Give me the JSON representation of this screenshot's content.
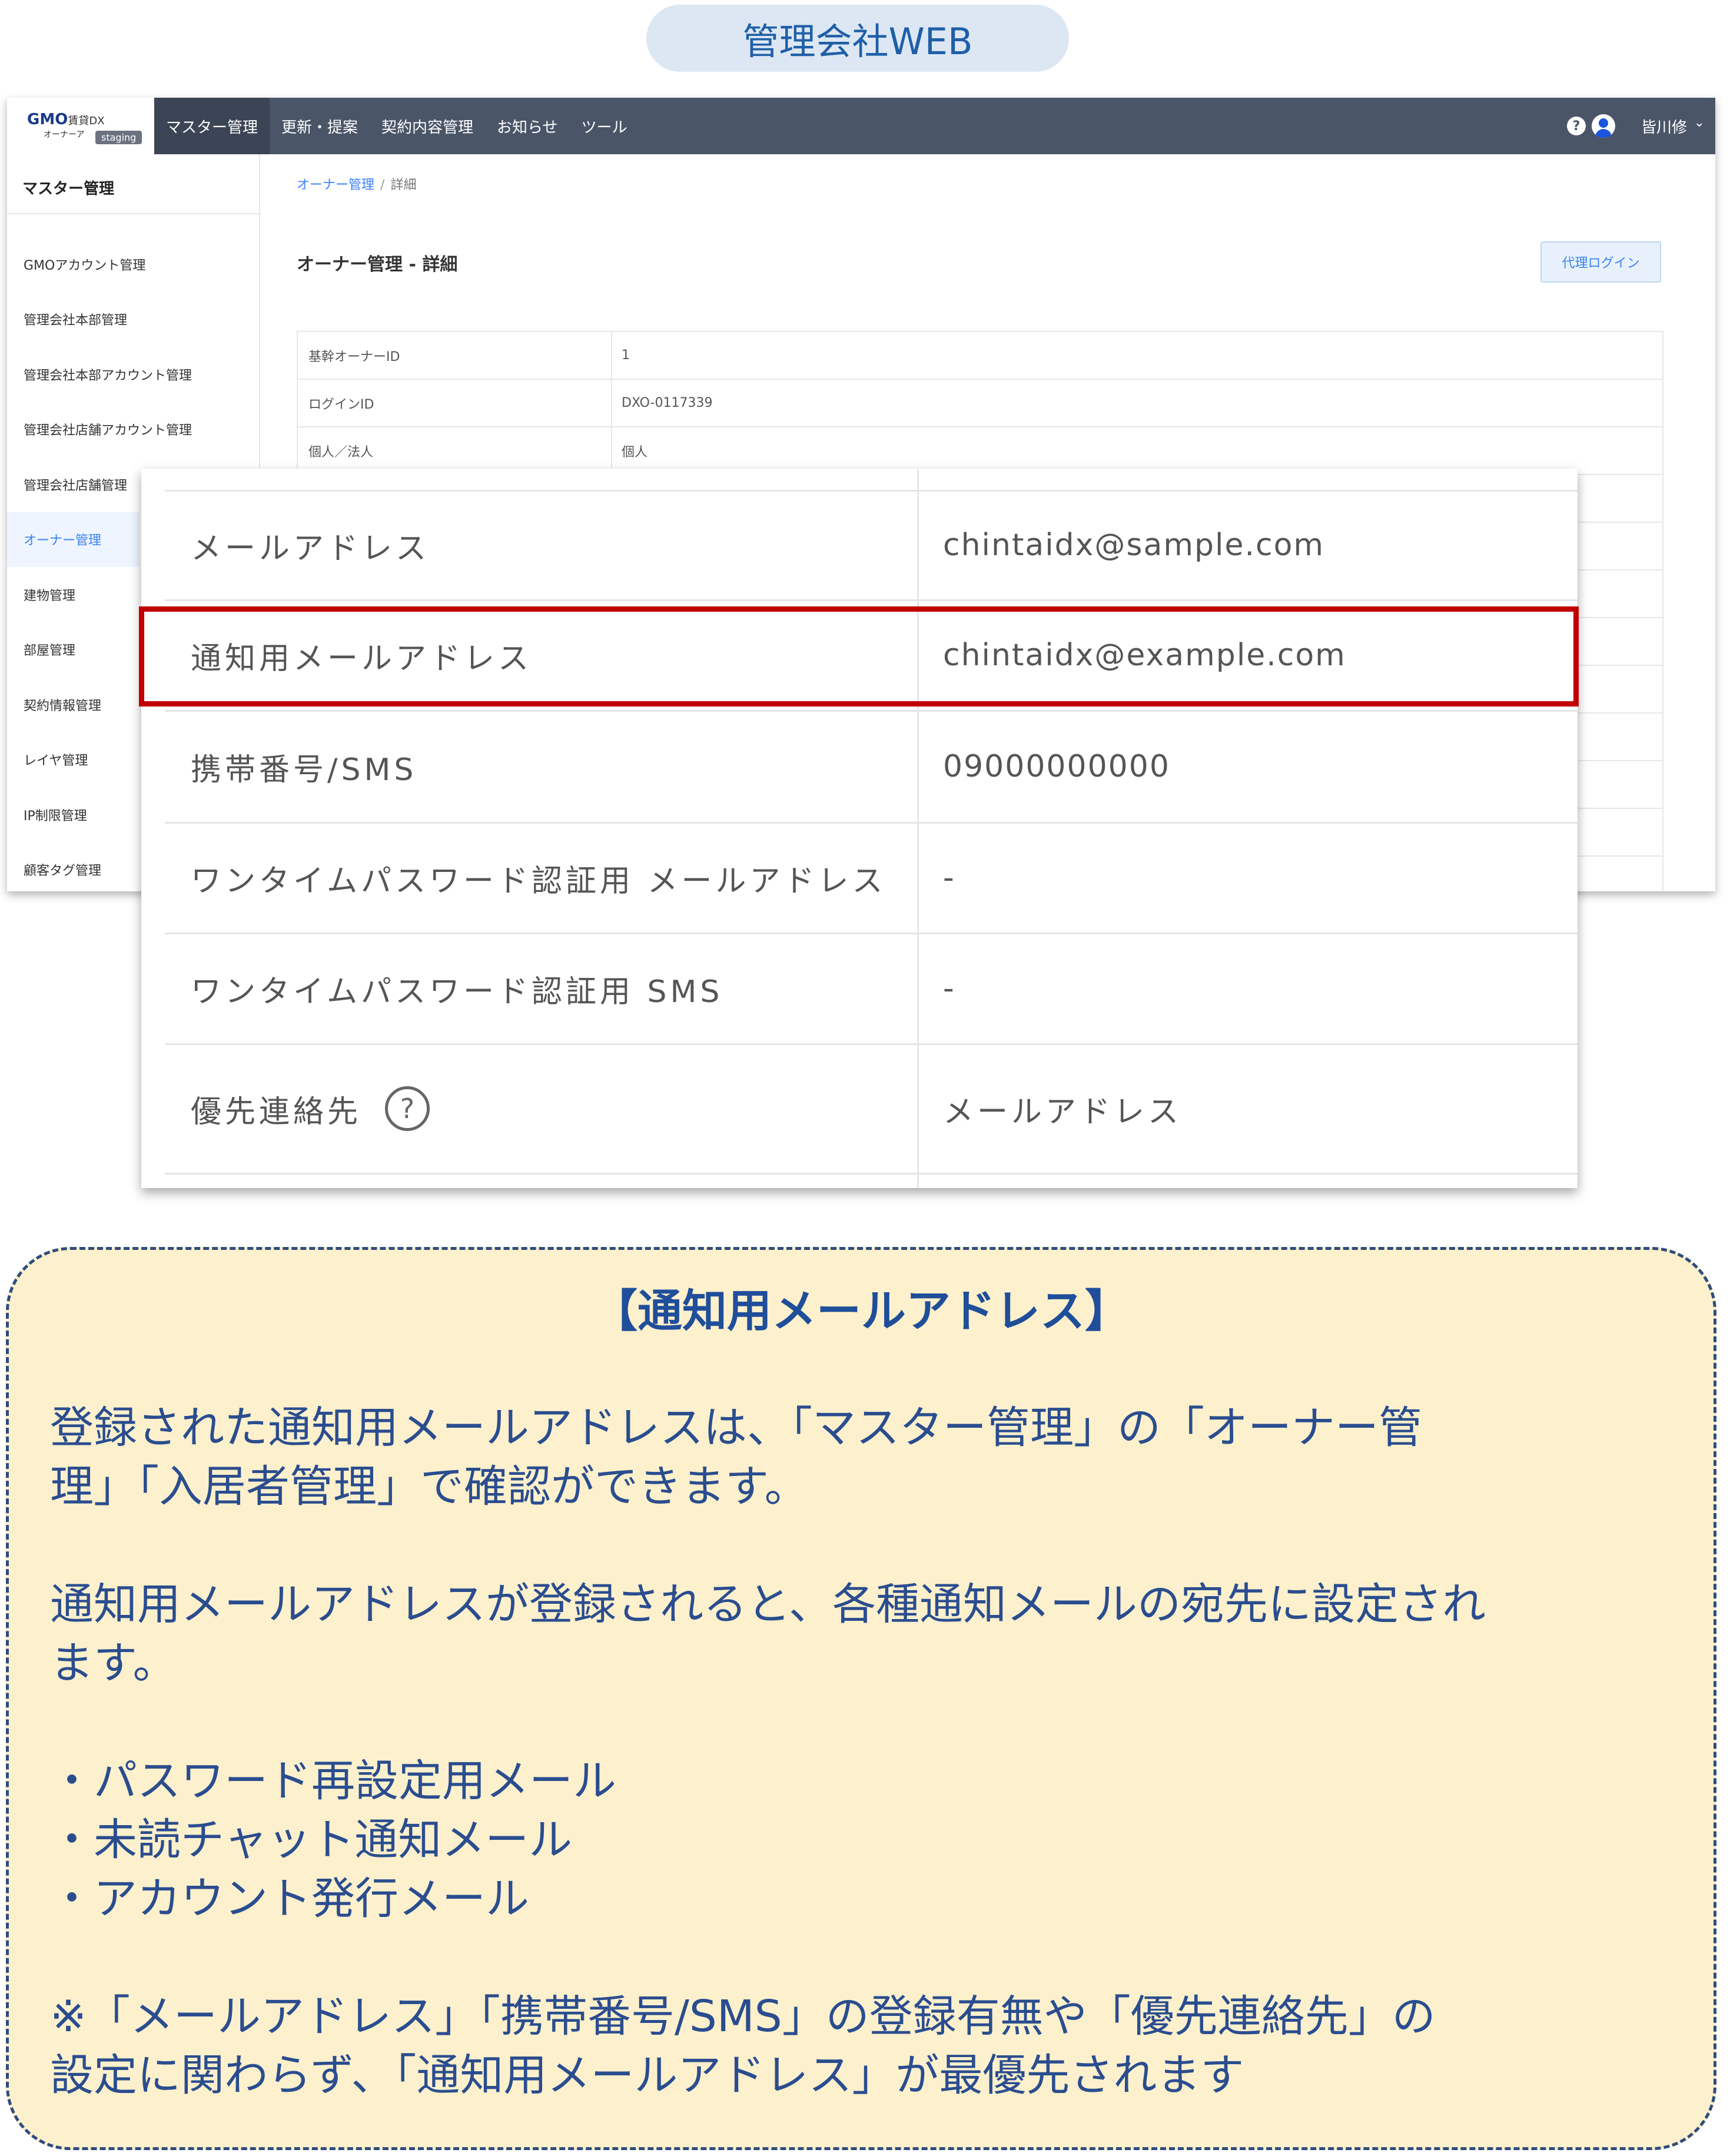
{
  "header_pill": "管理会社WEB",
  "app": {
    "logo": {
      "main": "GMO",
      "product": "賃貸DX",
      "sub": "オーナーア",
      "env": "staging"
    },
    "nav": [
      "マスター管理",
      "更新・提案",
      "契約内容管理",
      "お知らせ",
      "ツール"
    ],
    "help": "?",
    "user_name": "皆川修",
    "user_caret": "⌄",
    "sidebar": {
      "title": "マスター管理",
      "items": [
        "GMOアカウント管理",
        "管理会社本部管理",
        "管理会社本部アカウント管理",
        "管理会社店舗アカウント管理",
        "管理会社店舗管理",
        "オーナー管理",
        "建物管理",
        "部屋管理",
        "契約情報管理",
        "レイヤ管理",
        "IP制限管理",
        "顧客タグ管理"
      ]
    },
    "breadcrumb": {
      "parent": "オーナー管理",
      "sep": "/",
      "current": "詳細"
    },
    "page_title": "オーナー管理 - 詳細",
    "proxy_login": "代理ログイン",
    "rows": [
      {
        "key": "基幹オーナーID",
        "value": "1"
      },
      {
        "key": "ログインID",
        "value": "DXO-0117339"
      },
      {
        "key": "個人／法人",
        "value": "個人"
      }
    ]
  },
  "zoom": {
    "rows": [
      {
        "key": "メールアドレス",
        "value": "chintaidx@sample.com"
      },
      {
        "key": "通知用メールアドレス",
        "value": "chintaidx@example.com"
      },
      {
        "key": "携帯番号/SMS",
        "value": "09000000000"
      },
      {
        "key": "ワンタイムパスワード認証用 メールアドレス",
        "value": "-"
      },
      {
        "key": "ワンタイムパスワード認証用 SMS",
        "value": "-"
      },
      {
        "key": "優先連絡先",
        "value": "メールアドレス"
      }
    ],
    "help_icon": "?"
  },
  "info": {
    "title": "【通知用メールアドレス】",
    "para1_l1": "登録された通知用メールアドレスは、「マスター管理」の「オーナー管",
    "para1_l2": "理」「入居者管理」で確認ができます。",
    "para2_l1": "通知用メールアドレスが登録されると、各種通知メールの宛先に設定され",
    "para2_l2": "ます。",
    "bullets": [
      "・パスワード再設定用メール",
      "・未読チャット通知メール",
      "・アカウント発行メール"
    ],
    "note_l1": "※「メールアドレス」「携帯番号/SMS」の登録有無や「優先連絡先」の",
    "note_l2": "設定に関わらず、「通知用メールアドレス」が最優先されます"
  },
  "colors": {
    "nav_bg": "#4a5568",
    "accent": "#3b82f6",
    "highlight": "#c00000",
    "info_bg": "#fdf0cc",
    "info_text": "#2a4d8f"
  }
}
